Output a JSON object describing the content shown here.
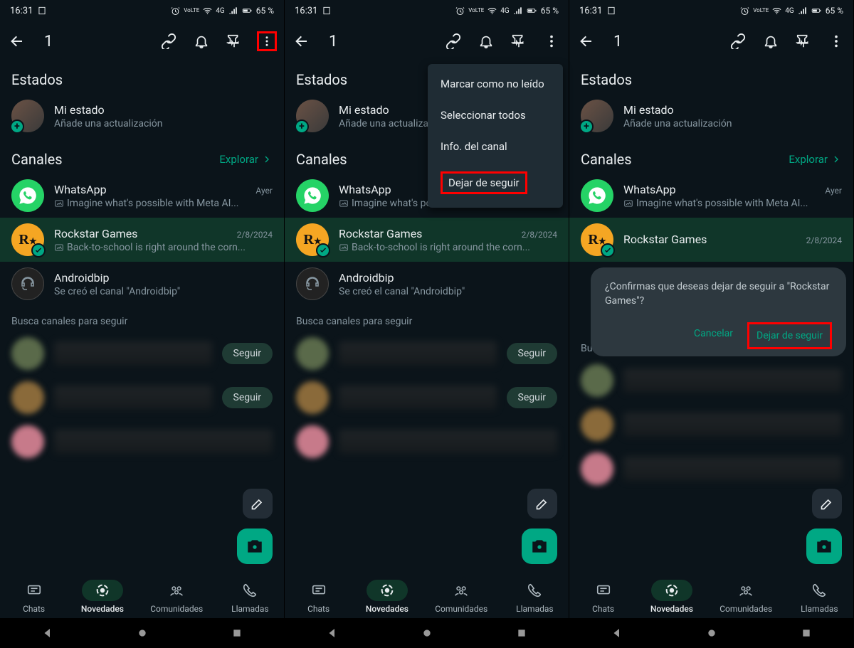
{
  "status": {
    "time": "16:31",
    "network": "4G",
    "battery": "65 %",
    "volte": "VoLTE"
  },
  "toolbar": {
    "count": "1"
  },
  "sections": {
    "estados": "Estados",
    "mystatus_title": "Mi estado",
    "mystatus_sub": "Añade una actualización",
    "canales": "Canales",
    "explorar": "Explorar",
    "discover": "Busca canales para seguir"
  },
  "channels": [
    {
      "name": "WhatsApp",
      "date": "Ayer",
      "sub": "Imagine what's possible with Meta AI..."
    },
    {
      "name": "Rockstar Games",
      "date": "2/8/2024",
      "sub": "Back-to-school is right around the corn..."
    },
    {
      "name": "Androidbip",
      "date": "",
      "sub": "Se creó el canal \"Androidbip\""
    }
  ],
  "follow": "Seguir",
  "nav": {
    "chats": "Chats",
    "novedades": "Novedades",
    "comunidades": "Comunidades",
    "llamadas": "Llamadas"
  },
  "menu": {
    "unread": "Marcar como no leído",
    "select_all": "Seleccionar todos",
    "info": "Info. del canal",
    "unfollow": "Dejar de seguir"
  },
  "dialog": {
    "text": "¿Confirmas que deseas dejar de seguir a \"Rockstar Games\"?",
    "cancel": "Cancelar",
    "confirm": "Dejar de seguir"
  }
}
